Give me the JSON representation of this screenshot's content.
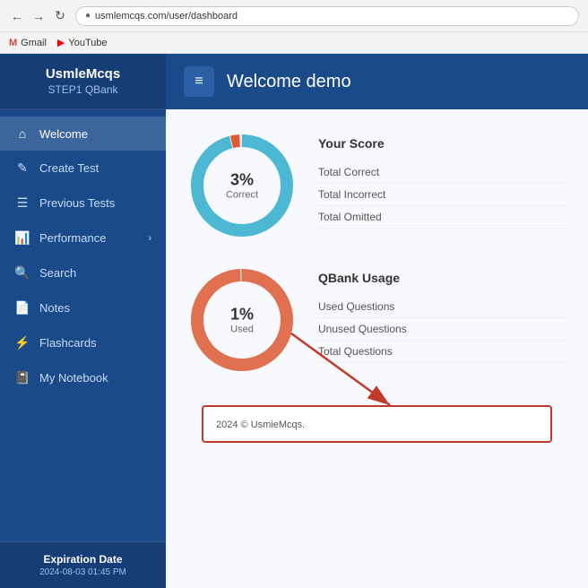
{
  "browser": {
    "url": "usmlemcqs.com/user/dashboard",
    "back_label": "←",
    "forward_label": "→",
    "reload_label": "↻",
    "bookmarks": [
      {
        "name": "Gmail",
        "type": "gmail"
      },
      {
        "name": "YouTube",
        "type": "youtube"
      }
    ]
  },
  "sidebar": {
    "logo_title": "UsmleMcqs",
    "logo_subtitle": "STEP1 QBank",
    "nav_items": [
      {
        "id": "welcome",
        "label": "Welcome",
        "icon": "⌂",
        "active": true
      },
      {
        "id": "create-test",
        "label": "Create Test",
        "icon": "✎"
      },
      {
        "id": "previous-tests",
        "label": "Previous Tests",
        "icon": "☰"
      },
      {
        "id": "performance",
        "label": "Performance",
        "icon": "📊",
        "has_chevron": true
      },
      {
        "id": "search",
        "label": "Search",
        "icon": "🔍"
      },
      {
        "id": "notes",
        "label": "Notes",
        "icon": "📄"
      },
      {
        "id": "flashcards",
        "label": "Flashcards",
        "icon": "⚡"
      },
      {
        "id": "my-notebook",
        "label": "My Notebook",
        "icon": "📓"
      }
    ],
    "expiration_label": "Expiration Date",
    "expiration_date": "2024-08-03 01:45 PM"
  },
  "header": {
    "hamburger_label": "≡",
    "title": "Welcome demo"
  },
  "score_section": {
    "title": "Your Score",
    "items": [
      {
        "label": "Total Correct"
      },
      {
        "label": "Total Incorrect"
      },
      {
        "label": "Total Omitted"
      }
    ]
  },
  "correct_chart": {
    "percent": "3%",
    "label": "Correct",
    "value": 3,
    "color_main": "#4db8d4",
    "color_accent": "#e05a3a",
    "color_bg": "#e8e8e8"
  },
  "usage_section": {
    "title": "QBank Usage",
    "items": [
      {
        "label": "Used Questions"
      },
      {
        "label": "Unused Questions"
      },
      {
        "label": "Total Questions"
      }
    ]
  },
  "used_chart": {
    "percent": "1%",
    "label": "Used",
    "value": 1,
    "color_main": "#e07050",
    "color_accent": "#5cb85c",
    "color_bg": "#e8e8e8"
  },
  "footer": {
    "text": "2024 © UsmieMcqs."
  }
}
